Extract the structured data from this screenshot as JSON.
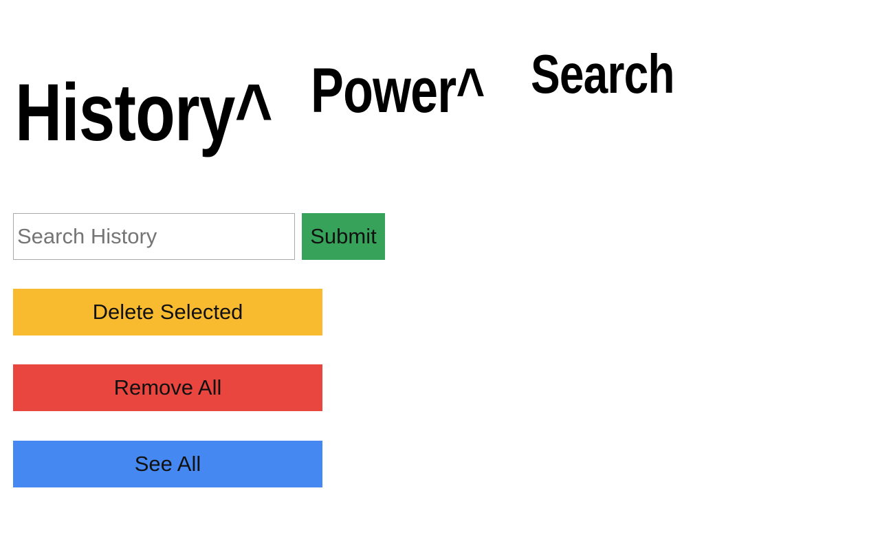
{
  "logo": {
    "part1": "History^",
    "part2": "Power^",
    "part3": "Search"
  },
  "search": {
    "placeholder": "Search History",
    "value": ""
  },
  "buttons": {
    "submit": "Submit",
    "delete_selected": "Delete Selected",
    "remove_all": "Remove All",
    "see_all": "See All"
  },
  "colors": {
    "submit": "#37a35a",
    "delete_selected": "#f8ba2f",
    "remove_all": "#e8463e",
    "see_all": "#4688f1"
  }
}
